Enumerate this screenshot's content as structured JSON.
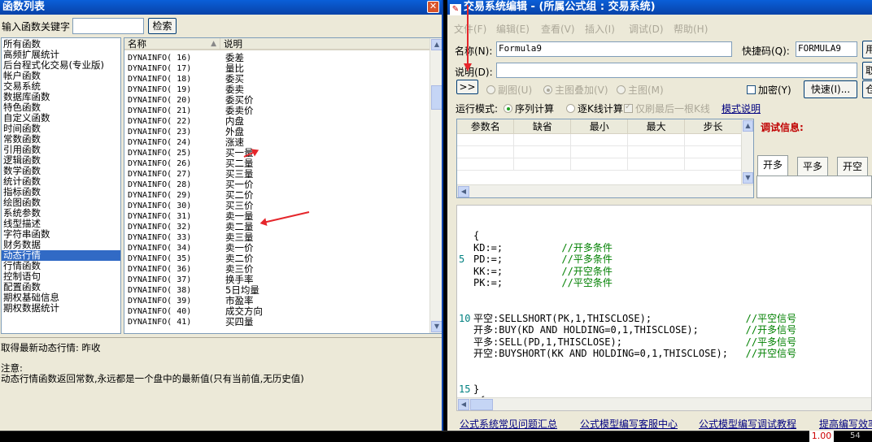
{
  "left": {
    "title": "函数列表",
    "search_label": "输入函数关键字",
    "search_value": "",
    "search_button": "检索",
    "categories": [
      "所有函数",
      "高频扩展统计",
      "后台程式化交易(专业版)",
      "帐户函数",
      "交易系统",
      "数据库函数",
      "特色函数",
      "自定义函数",
      "时间函数",
      "常数函数",
      "引用函数",
      "逻辑函数",
      "数学函数",
      "统计函数",
      "指标函数",
      "绘图函数",
      "系统参数",
      "线型描述",
      "字符串函数",
      "财务数据",
      "动态行情",
      "行情函数",
      "控制语句",
      "配置函数",
      "期权基础信息",
      "期权数据统计"
    ],
    "selected_category": "动态行情",
    "col_name": "名称",
    "col_desc": "说明",
    "functions": [
      {
        "code": "DYNAINFO( 16)",
        "desc": "委差"
      },
      {
        "code": "DYNAINFO( 17)",
        "desc": "量比"
      },
      {
        "code": "DYNAINFO( 18)",
        "desc": "委买"
      },
      {
        "code": "DYNAINFO( 19)",
        "desc": "委卖"
      },
      {
        "code": "DYNAINFO( 20)",
        "desc": "委买价"
      },
      {
        "code": "DYNAINFO( 21)",
        "desc": "委卖价"
      },
      {
        "code": "DYNAINFO( 22)",
        "desc": "内盘"
      },
      {
        "code": "DYNAINFO( 23)",
        "desc": "外盘"
      },
      {
        "code": "DYNAINFO( 24)",
        "desc": "涨速"
      },
      {
        "code": "DYNAINFO( 25)",
        "desc": "买一量"
      },
      {
        "code": "DYNAINFO( 26)",
        "desc": "买二量"
      },
      {
        "code": "DYNAINFO( 27)",
        "desc": "买三量"
      },
      {
        "code": "DYNAINFO( 28)",
        "desc": "买一价"
      },
      {
        "code": "DYNAINFO( 29)",
        "desc": "买二价"
      },
      {
        "code": "DYNAINFO( 30)",
        "desc": "买三价"
      },
      {
        "code": "DYNAINFO( 31)",
        "desc": "卖一量"
      },
      {
        "code": "DYNAINFO( 32)",
        "desc": "卖二量"
      },
      {
        "code": "DYNAINFO( 33)",
        "desc": "卖三量"
      },
      {
        "code": "DYNAINFO( 34)",
        "desc": "卖一价"
      },
      {
        "code": "DYNAINFO( 35)",
        "desc": "卖二价"
      },
      {
        "code": "DYNAINFO( 36)",
        "desc": "卖三价"
      },
      {
        "code": "DYNAINFO( 37)",
        "desc": "换手率"
      },
      {
        "code": "DYNAINFO( 38)",
        "desc": "5日均量"
      },
      {
        "code": "DYNAINFO( 39)",
        "desc": "市盈率"
      },
      {
        "code": "DYNAINFO( 40)",
        "desc": "成交方向"
      },
      {
        "code": "DYNAINFO( 41)",
        "desc": "买四量"
      }
    ],
    "desc_line1": "取得最新动态行情: 昨收",
    "desc_line2": "注意:",
    "desc_line3": "动态行情函数返回常数,永远都是一个盘中的最新值(只有当前值,无历史值)"
  },
  "right": {
    "title": "交易系统编辑 - (所属公式组 : 交易系统)",
    "menu": [
      "文件(F)",
      "编辑(E)",
      "查看(V)",
      "插入(I)",
      "调试(D)",
      "帮助(H)"
    ],
    "name_label": "名称(N):",
    "name_value": "Formula9",
    "shortcut_label": "快捷码(Q):",
    "shortcut_value": "FORMULA9",
    "desc_label": "说明(D):",
    "desc_value": "",
    "expand_button": ">>",
    "sub_chart": "副图(U)",
    "main_overlay": "主图叠加(V)",
    "main_chart": "主图(M)",
    "encrypt": "加密(Y)",
    "quick_button": "快速(I)...",
    "run_mode_label": "运行模式:",
    "seq_calc": "序列计算",
    "bar_calc": "逐K线计算",
    "last_bar": "仅刷最后一根K线",
    "mode_help": "模式说明",
    "param_headers": [
      "参数名",
      "缺省",
      "最小",
      "最大",
      "步长"
    ],
    "debug_label": "调试信息:",
    "tabs": [
      "开多",
      "平多",
      "开空"
    ],
    "code_lines": [
      {
        "num": "",
        "code": "{",
        "comment": ""
      },
      {
        "num": "",
        "code": "KD:=;          ",
        "comment": "//开多条件"
      },
      {
        "num": "5",
        "code": "PD:=;          ",
        "comment": "//平多条件"
      },
      {
        "num": "",
        "code": "KK:=;          ",
        "comment": "//开空条件"
      },
      {
        "num": "",
        "code": "PK:=;          ",
        "comment": "//平空条件"
      },
      {
        "num": "",
        "code": "",
        "comment": ""
      },
      {
        "num": "",
        "code": "",
        "comment": ""
      },
      {
        "num": "10",
        "code": "平空:SELLSHORT(PK,1,THISCLOSE);                ",
        "comment": "//平空信号"
      },
      {
        "num": "",
        "code": "开多:BUY(KD AND HOLDING=0,1,THISCLOSE);        ",
        "comment": "//开多信号"
      },
      {
        "num": "",
        "code": "平多:SELL(PD,1,THISCLOSE);                     ",
        "comment": "//平多信号"
      },
      {
        "num": "",
        "code": "开空:BUYSHORT(KK AND HOLDING=0,1,THISCLOSE);   ",
        "comment": "//开空信号"
      },
      {
        "num": "",
        "code": "",
        "comment": ""
      },
      {
        "num": "",
        "code": "",
        "comment": ""
      },
      {
        "num": "15",
        "code": "}",
        "comment": ""
      },
      {
        "num": "",
        "code": " {",
        "comment": ""
      }
    ],
    "links": [
      "公式系统常见问题汇总",
      "公式模型编写客服中心",
      "公式模型编写调试教程",
      "提高编写效率"
    ]
  },
  "bottom_value": "1.00",
  "bottom_value2": "54",
  "colors": {
    "titlebar": "#0842a8",
    "selection": "#316ac5",
    "comment": "#008000",
    "arrow": "#e5262b"
  }
}
